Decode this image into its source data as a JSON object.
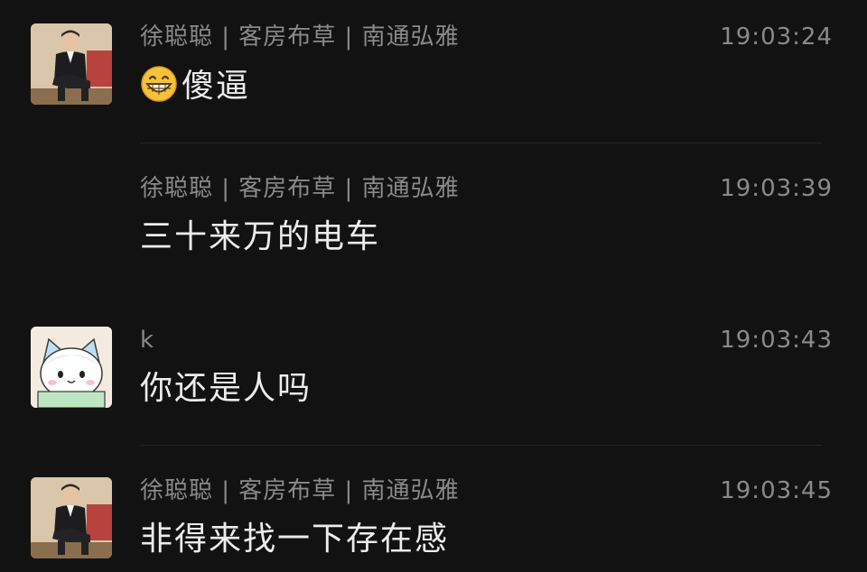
{
  "messages": [
    {
      "sender": "徐聪聪 | 客房布草 | 南通弘雅",
      "time": "19:03:24",
      "text": "傻逼",
      "emoji": "grinning-face-icon",
      "avatar": "man-in-suit-avatar"
    },
    {
      "sender": "徐聪聪 | 客房布草 | 南通弘雅",
      "time": "19:03:39",
      "text": "三十来万的电车"
    },
    {
      "sender": "k",
      "time": "19:03:43",
      "text": "你还是人吗",
      "avatar": "cartoon-cat-avatar"
    },
    {
      "sender": "徐聪聪 | 客房布草 | 南通弘雅",
      "time": "19:03:45",
      "text": "非得来找一下存在感",
      "avatar": "man-in-suit-avatar"
    }
  ],
  "colors": {
    "background": "#121212",
    "sender_text": "#8a8a8a",
    "message_text": "#ececec",
    "divider": "#262626"
  }
}
